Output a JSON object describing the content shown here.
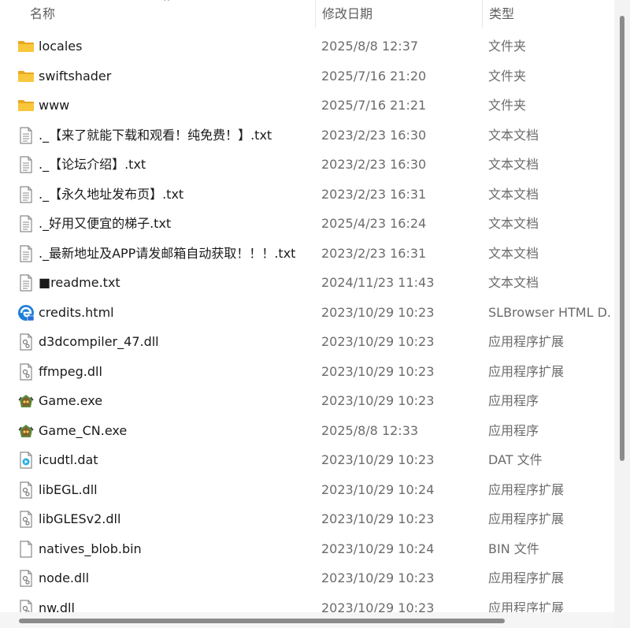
{
  "columns": {
    "name": "名称",
    "date_modified": "修改日期",
    "type": "类型"
  },
  "files": [
    {
      "name": "locales",
      "date": "2025/8/8 12:37",
      "type": "文件夹",
      "icon": "folder-icon"
    },
    {
      "name": "swiftshader",
      "date": "2025/7/16 21:20",
      "type": "文件夹",
      "icon": "folder-icon"
    },
    {
      "name": "www",
      "date": "2025/7/16 21:21",
      "type": "文件夹",
      "icon": "folder-icon"
    },
    {
      "name": "._【来了就能下载和观看！纯免费！】.txt",
      "date": "2023/2/23 16:30",
      "type": "文本文档",
      "icon": "text-file-icon"
    },
    {
      "name": "._【论坛介绍】.txt",
      "date": "2023/2/23 16:30",
      "type": "文本文档",
      "icon": "text-file-icon"
    },
    {
      "name": "._【永久地址发布页】.txt",
      "date": "2023/2/23 16:31",
      "type": "文本文档",
      "icon": "text-file-icon"
    },
    {
      "name": "._好用又便宜的梯子.txt",
      "date": "2025/4/23 16:24",
      "type": "文本文档",
      "icon": "text-file-icon"
    },
    {
      "name": "._最新地址及APP请发邮箱自动获取！！！.txt",
      "date": "2023/2/23 16:31",
      "type": "文本文档",
      "icon": "text-file-icon"
    },
    {
      "name": "■readme.txt",
      "date": "2024/11/23 11:43",
      "type": "文本文档",
      "icon": "text-file-icon"
    },
    {
      "name": "credits.html",
      "date": "2023/10/29 10:23",
      "type": "SLBrowser HTML D...",
      "icon": "browser-html-icon"
    },
    {
      "name": "d3dcompiler_47.dll",
      "date": "2023/10/29 10:23",
      "type": "应用程序扩展",
      "icon": "dll-file-icon"
    },
    {
      "name": "ffmpeg.dll",
      "date": "2023/10/29 10:23",
      "type": "应用程序扩展",
      "icon": "dll-file-icon"
    },
    {
      "name": "Game.exe",
      "date": "2023/10/29 10:23",
      "type": "应用程序",
      "icon": "game-exe-icon"
    },
    {
      "name": "Game_CN.exe",
      "date": "2025/8/8 12:33",
      "type": "应用程序",
      "icon": "game-exe-icon"
    },
    {
      "name": "icudtl.dat",
      "date": "2023/10/29 10:23",
      "type": "DAT 文件",
      "icon": "media-file-icon"
    },
    {
      "name": "libEGL.dll",
      "date": "2023/10/29 10:24",
      "type": "应用程序扩展",
      "icon": "dll-file-icon"
    },
    {
      "name": "libGLESv2.dll",
      "date": "2023/10/29 10:23",
      "type": "应用程序扩展",
      "icon": "dll-file-icon"
    },
    {
      "name": "natives_blob.bin",
      "date": "2023/10/29 10:24",
      "type": "BIN 文件",
      "icon": "blank-file-icon"
    },
    {
      "name": "node.dll",
      "date": "2023/10/29 10:23",
      "type": "应用程序扩展",
      "icon": "dll-file-icon"
    },
    {
      "name": "nw.dll",
      "date": "2023/10/29 10:23",
      "type": "应用程序扩展",
      "icon": "dll-file-icon"
    }
  ],
  "colors": {
    "folder": "#f8c73c",
    "folder_dark": "#e8a820",
    "text_primary": "#1a1a1a",
    "text_secondary": "#6b6b6b",
    "header_text": "#5e5e5e",
    "scroll_thumb": "#8b8b8b"
  }
}
